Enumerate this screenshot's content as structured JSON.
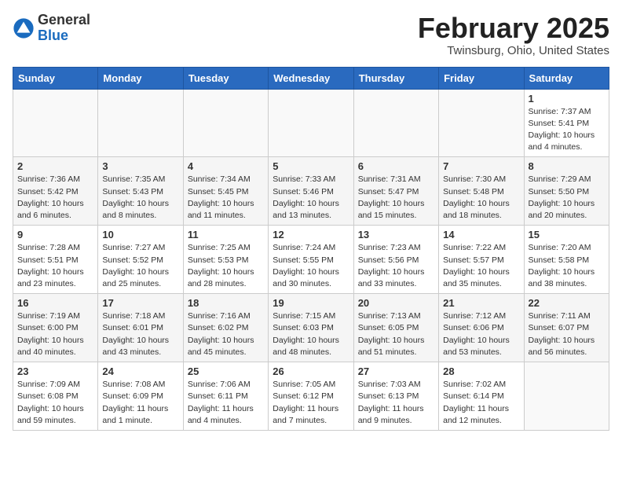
{
  "header": {
    "logo_general": "General",
    "logo_blue": "Blue",
    "month_title": "February 2025",
    "location": "Twinsburg, Ohio, United States"
  },
  "weekdays": [
    "Sunday",
    "Monday",
    "Tuesday",
    "Wednesday",
    "Thursday",
    "Friday",
    "Saturday"
  ],
  "weeks": [
    [
      {
        "day": "",
        "info": ""
      },
      {
        "day": "",
        "info": ""
      },
      {
        "day": "",
        "info": ""
      },
      {
        "day": "",
        "info": ""
      },
      {
        "day": "",
        "info": ""
      },
      {
        "day": "",
        "info": ""
      },
      {
        "day": "1",
        "info": "Sunrise: 7:37 AM\nSunset: 5:41 PM\nDaylight: 10 hours and 4 minutes."
      }
    ],
    [
      {
        "day": "2",
        "info": "Sunrise: 7:36 AM\nSunset: 5:42 PM\nDaylight: 10 hours and 6 minutes."
      },
      {
        "day": "3",
        "info": "Sunrise: 7:35 AM\nSunset: 5:43 PM\nDaylight: 10 hours and 8 minutes."
      },
      {
        "day": "4",
        "info": "Sunrise: 7:34 AM\nSunset: 5:45 PM\nDaylight: 10 hours and 11 minutes."
      },
      {
        "day": "5",
        "info": "Sunrise: 7:33 AM\nSunset: 5:46 PM\nDaylight: 10 hours and 13 minutes."
      },
      {
        "day": "6",
        "info": "Sunrise: 7:31 AM\nSunset: 5:47 PM\nDaylight: 10 hours and 15 minutes."
      },
      {
        "day": "7",
        "info": "Sunrise: 7:30 AM\nSunset: 5:48 PM\nDaylight: 10 hours and 18 minutes."
      },
      {
        "day": "8",
        "info": "Sunrise: 7:29 AM\nSunset: 5:50 PM\nDaylight: 10 hours and 20 minutes."
      }
    ],
    [
      {
        "day": "9",
        "info": "Sunrise: 7:28 AM\nSunset: 5:51 PM\nDaylight: 10 hours and 23 minutes."
      },
      {
        "day": "10",
        "info": "Sunrise: 7:27 AM\nSunset: 5:52 PM\nDaylight: 10 hours and 25 minutes."
      },
      {
        "day": "11",
        "info": "Sunrise: 7:25 AM\nSunset: 5:53 PM\nDaylight: 10 hours and 28 minutes."
      },
      {
        "day": "12",
        "info": "Sunrise: 7:24 AM\nSunset: 5:55 PM\nDaylight: 10 hours and 30 minutes."
      },
      {
        "day": "13",
        "info": "Sunrise: 7:23 AM\nSunset: 5:56 PM\nDaylight: 10 hours and 33 minutes."
      },
      {
        "day": "14",
        "info": "Sunrise: 7:22 AM\nSunset: 5:57 PM\nDaylight: 10 hours and 35 minutes."
      },
      {
        "day": "15",
        "info": "Sunrise: 7:20 AM\nSunset: 5:58 PM\nDaylight: 10 hours and 38 minutes."
      }
    ],
    [
      {
        "day": "16",
        "info": "Sunrise: 7:19 AM\nSunset: 6:00 PM\nDaylight: 10 hours and 40 minutes."
      },
      {
        "day": "17",
        "info": "Sunrise: 7:18 AM\nSunset: 6:01 PM\nDaylight: 10 hours and 43 minutes."
      },
      {
        "day": "18",
        "info": "Sunrise: 7:16 AM\nSunset: 6:02 PM\nDaylight: 10 hours and 45 minutes."
      },
      {
        "day": "19",
        "info": "Sunrise: 7:15 AM\nSunset: 6:03 PM\nDaylight: 10 hours and 48 minutes."
      },
      {
        "day": "20",
        "info": "Sunrise: 7:13 AM\nSunset: 6:05 PM\nDaylight: 10 hours and 51 minutes."
      },
      {
        "day": "21",
        "info": "Sunrise: 7:12 AM\nSunset: 6:06 PM\nDaylight: 10 hours and 53 minutes."
      },
      {
        "day": "22",
        "info": "Sunrise: 7:11 AM\nSunset: 6:07 PM\nDaylight: 10 hours and 56 minutes."
      }
    ],
    [
      {
        "day": "23",
        "info": "Sunrise: 7:09 AM\nSunset: 6:08 PM\nDaylight: 10 hours and 59 minutes."
      },
      {
        "day": "24",
        "info": "Sunrise: 7:08 AM\nSunset: 6:09 PM\nDaylight: 11 hours and 1 minute."
      },
      {
        "day": "25",
        "info": "Sunrise: 7:06 AM\nSunset: 6:11 PM\nDaylight: 11 hours and 4 minutes."
      },
      {
        "day": "26",
        "info": "Sunrise: 7:05 AM\nSunset: 6:12 PM\nDaylight: 11 hours and 7 minutes."
      },
      {
        "day": "27",
        "info": "Sunrise: 7:03 AM\nSunset: 6:13 PM\nDaylight: 11 hours and 9 minutes."
      },
      {
        "day": "28",
        "info": "Sunrise: 7:02 AM\nSunset: 6:14 PM\nDaylight: 11 hours and 12 minutes."
      },
      {
        "day": "",
        "info": ""
      }
    ]
  ]
}
